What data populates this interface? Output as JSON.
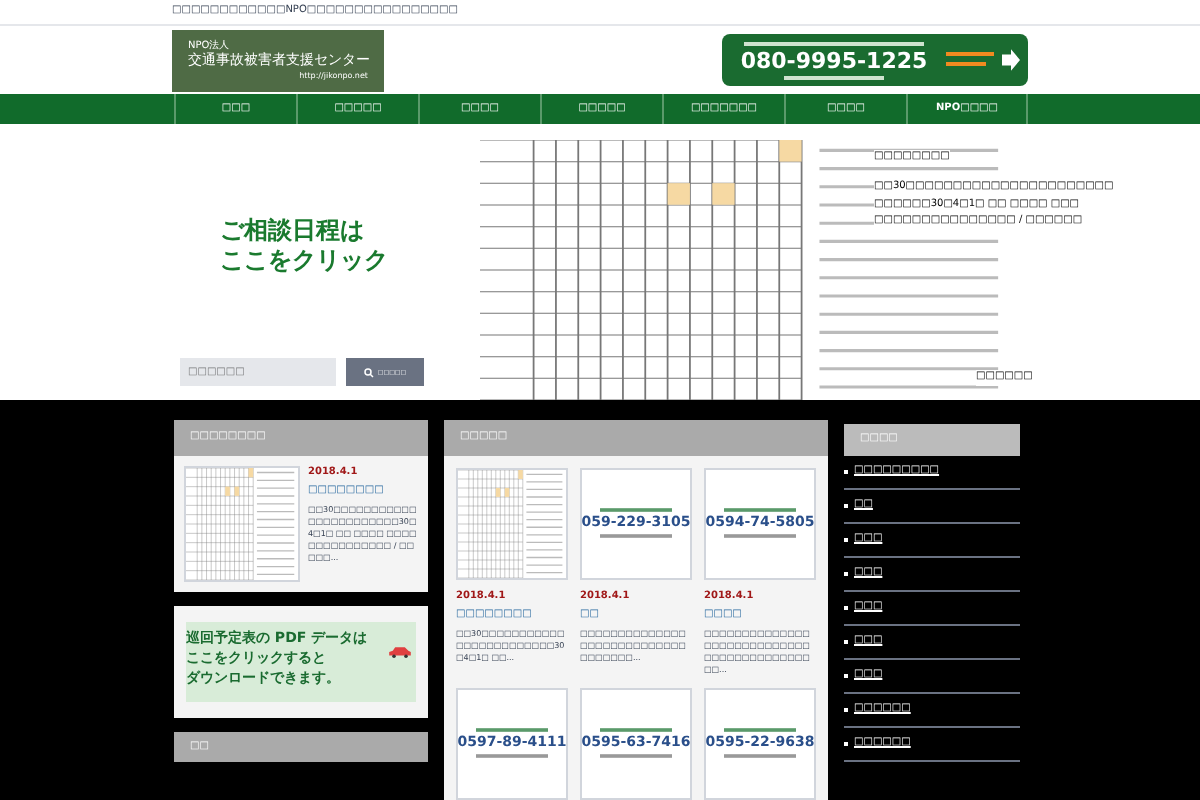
{
  "top_bar": {
    "text": "□□□□□□□□□□□□NPO□□□□□□□□□□□□□□□□"
  },
  "logo": {
    "line_1": "NPO法人",
    "line_2": "交通事故被害者支援センター",
    "url": "http://jikonpo.net"
  },
  "phone_banner": {
    "phone": "080-9995-1225"
  },
  "nav": [
    {
      "label": "□□□"
    },
    {
      "label": "□□□□□"
    },
    {
      "label": "□□□□"
    },
    {
      "label": "□□□□□"
    },
    {
      "label": "□□□□□□□"
    },
    {
      "label": "□□□□"
    },
    {
      "label": "NPO□□□□"
    }
  ],
  "hero": {
    "headline_1": "ご相談日程は",
    "headline_2": "ここをクリック",
    "search": {
      "placeholder": "□□□□□□",
      "button": "□□□□□"
    },
    "overlay_texts": [
      "□□□□□□□□",
      "□□30□□□□□□□□□□□□□□□□□□□□□□",
      "□□□□□□30□4□1□ □□ □□□□ □□□",
      "□□□□□□□□□□□□□□□ / □□□□□□"
    ],
    "overlay_more": "□□□□□□"
  },
  "left_card": {
    "heading": "□□□□□□□□",
    "date": "2018.4.1",
    "title": "□□□□□□□□",
    "excerpt": "□□30□□□□□□□□□□□□□□□□□□□□□□□30□4□1□ □□ □□□□ □□□□□□□□□□□□□□□ / □□□□□..."
  },
  "pdf_banner": {
    "line_1": "巡回予定表の PDF データは",
    "line_2": "ここをクリックすると",
    "line_3": "ダウンロードできます。"
  },
  "left_next_heading": "□□",
  "news": {
    "heading": "□□□□□",
    "cards": [
      {
        "kind": "schedule",
        "date": "2018.4.1",
        "title": "□□□□□□□□",
        "excerpt": "□□30□□□□□□□□□□□□□□□□□□□□□□□□30□4□1□ □□..."
      },
      {
        "kind": "phone",
        "phone": "059-229-3105",
        "date": "2018.4.1",
        "title": "□□",
        "excerpt": "□□□□□□□□□□□□□□□□□□□□□□□□□□□□□□□□□□□..."
      },
      {
        "kind": "phone",
        "phone": "0594-74-5805",
        "date": "2018.4.1",
        "title": "□□□□",
        "excerpt": "□□□□□□□□□□□□□□□□□□□□□□□□□□□□□□□□□□□□□□□□□□□□..."
      }
    ],
    "more_cards": [
      {
        "phone": "0597-89-4111"
      },
      {
        "phone": "0595-63-7416"
      },
      {
        "phone": "0595-22-9638"
      }
    ]
  },
  "sidebar": {
    "heading": "□□□□",
    "items": [
      {
        "label": "□□□□□□□□□"
      },
      {
        "label": "□□"
      },
      {
        "label": "□□□"
      },
      {
        "label": "□□□"
      },
      {
        "label": "□□□"
      },
      {
        "label": "□□□"
      },
      {
        "label": "□□□"
      },
      {
        "label": "□□□□□□"
      },
      {
        "label": "□□□□□□"
      }
    ]
  }
}
